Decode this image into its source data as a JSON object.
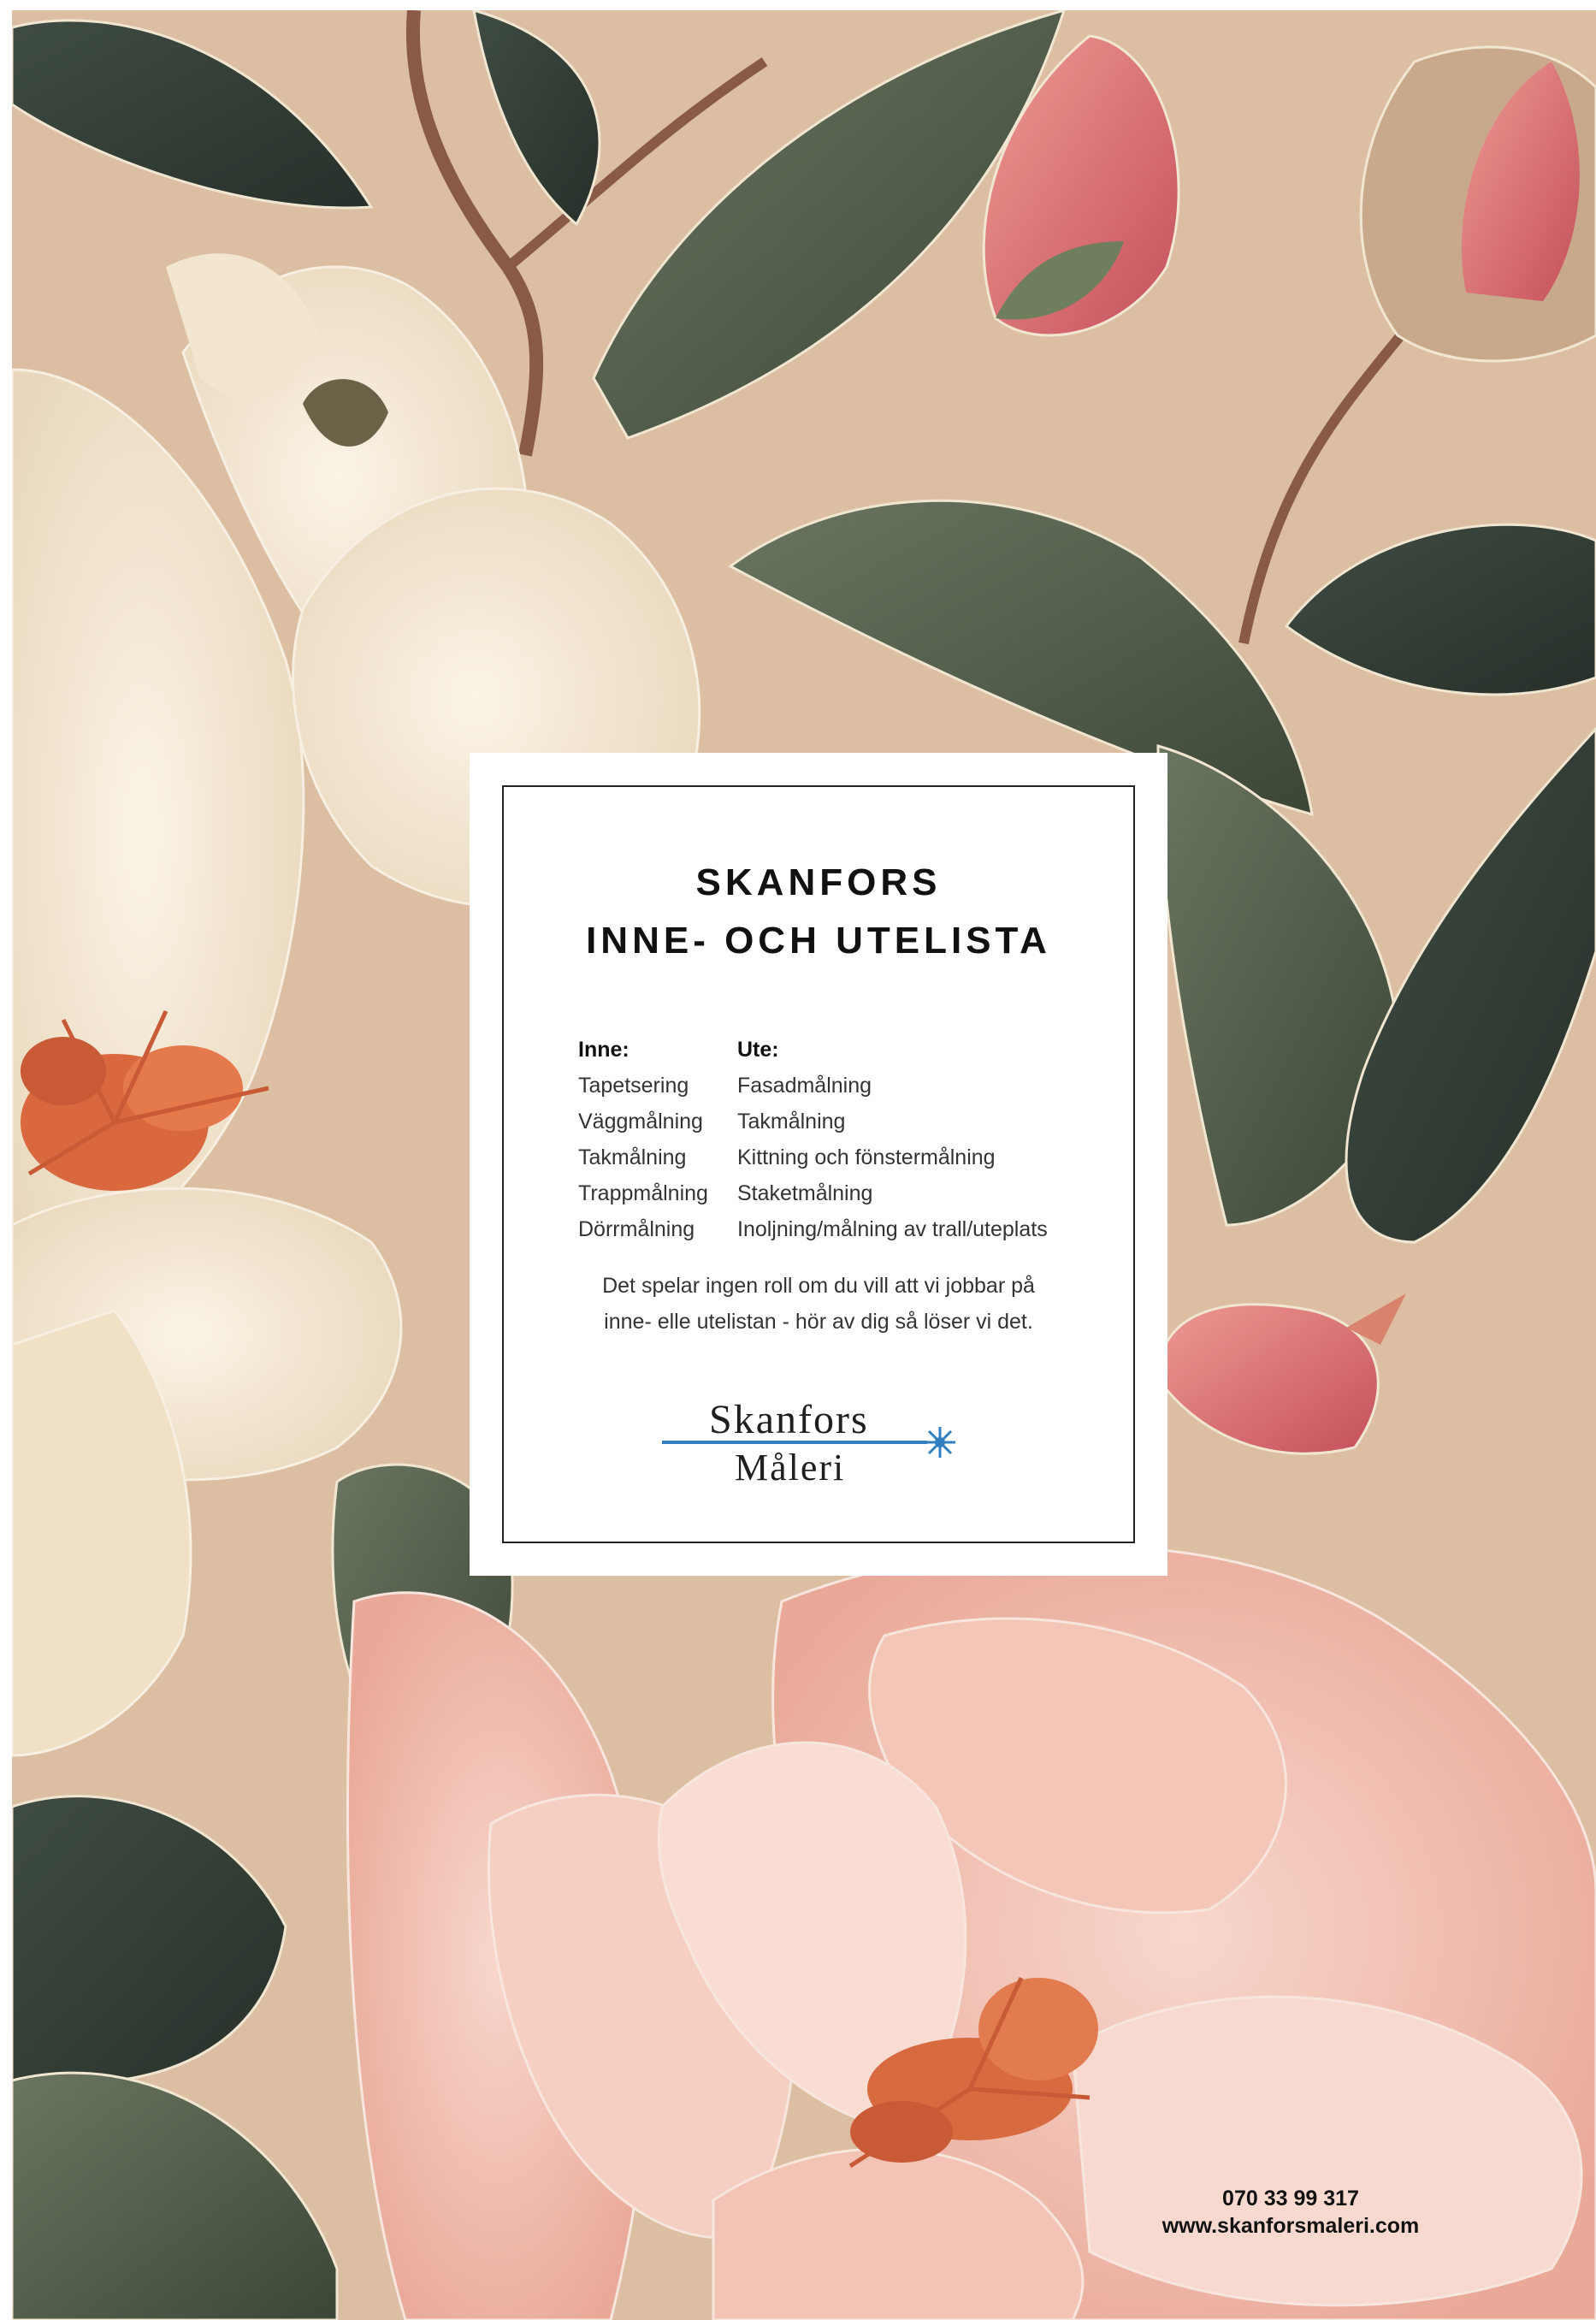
{
  "title": {
    "line1": "SKANFORS",
    "line2": "INNE- OCH UTELISTA"
  },
  "inne": {
    "heading": "Inne:",
    "items": [
      "Tapetsering",
      "Väggmålning",
      "Takmålning",
      "Trappmålning",
      "Dörrmålning"
    ]
  },
  "ute": {
    "heading": "Ute:",
    "items": [
      "Fasadmålning",
      "Takmålning",
      "Kittning och fönstermålning",
      "Staketmålning",
      "Inoljning/målning av trall/uteplats"
    ]
  },
  "note": {
    "line1": "Det spelar ingen roll om du vill att vi jobbar på",
    "line2": "inne- elle utelistan - hör av dig så löser vi det."
  },
  "logo": {
    "line1": "Skanfors",
    "line2": "Måleri",
    "accent_color": "#2f7fc1"
  },
  "contact": {
    "phone": "070 33 99 317",
    "website": "www.skanforsmaleri.com"
  },
  "colors": {
    "background": "#dcbfa2",
    "magnolia_cream": "#f4ead8",
    "magnolia_pink": "#f2c2b4",
    "bud_red": "#d96c6f",
    "leaf_green": "#4f5c48"
  }
}
